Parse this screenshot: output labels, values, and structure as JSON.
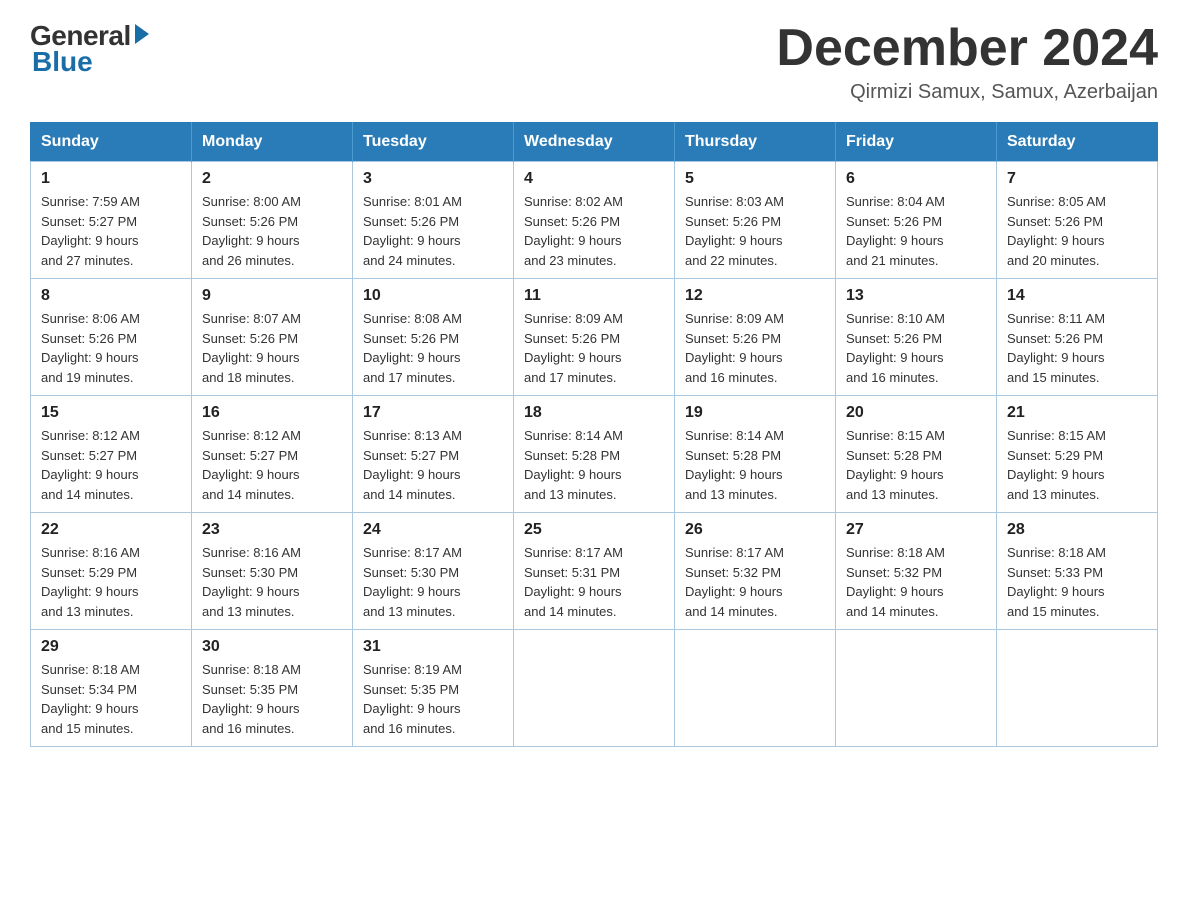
{
  "logo": {
    "general": "General",
    "blue": "Blue"
  },
  "header": {
    "title": "December 2024",
    "location": "Qirmizi Samux, Samux, Azerbaijan"
  },
  "weekdays": [
    "Sunday",
    "Monday",
    "Tuesday",
    "Wednesday",
    "Thursday",
    "Friday",
    "Saturday"
  ],
  "weeks": [
    [
      {
        "day": "1",
        "sunrise": "7:59 AM",
        "sunset": "5:27 PM",
        "daylight": "9 hours and 27 minutes."
      },
      {
        "day": "2",
        "sunrise": "8:00 AM",
        "sunset": "5:26 PM",
        "daylight": "9 hours and 26 minutes."
      },
      {
        "day": "3",
        "sunrise": "8:01 AM",
        "sunset": "5:26 PM",
        "daylight": "9 hours and 24 minutes."
      },
      {
        "day": "4",
        "sunrise": "8:02 AM",
        "sunset": "5:26 PM",
        "daylight": "9 hours and 23 minutes."
      },
      {
        "day": "5",
        "sunrise": "8:03 AM",
        "sunset": "5:26 PM",
        "daylight": "9 hours and 22 minutes."
      },
      {
        "day": "6",
        "sunrise": "8:04 AM",
        "sunset": "5:26 PM",
        "daylight": "9 hours and 21 minutes."
      },
      {
        "day": "7",
        "sunrise": "8:05 AM",
        "sunset": "5:26 PM",
        "daylight": "9 hours and 20 minutes."
      }
    ],
    [
      {
        "day": "8",
        "sunrise": "8:06 AM",
        "sunset": "5:26 PM",
        "daylight": "9 hours and 19 minutes."
      },
      {
        "day": "9",
        "sunrise": "8:07 AM",
        "sunset": "5:26 PM",
        "daylight": "9 hours and 18 minutes."
      },
      {
        "day": "10",
        "sunrise": "8:08 AM",
        "sunset": "5:26 PM",
        "daylight": "9 hours and 17 minutes."
      },
      {
        "day": "11",
        "sunrise": "8:09 AM",
        "sunset": "5:26 PM",
        "daylight": "9 hours and 17 minutes."
      },
      {
        "day": "12",
        "sunrise": "8:09 AM",
        "sunset": "5:26 PM",
        "daylight": "9 hours and 16 minutes."
      },
      {
        "day": "13",
        "sunrise": "8:10 AM",
        "sunset": "5:26 PM",
        "daylight": "9 hours and 16 minutes."
      },
      {
        "day": "14",
        "sunrise": "8:11 AM",
        "sunset": "5:26 PM",
        "daylight": "9 hours and 15 minutes."
      }
    ],
    [
      {
        "day": "15",
        "sunrise": "8:12 AM",
        "sunset": "5:27 PM",
        "daylight": "9 hours and 14 minutes."
      },
      {
        "day": "16",
        "sunrise": "8:12 AM",
        "sunset": "5:27 PM",
        "daylight": "9 hours and 14 minutes."
      },
      {
        "day": "17",
        "sunrise": "8:13 AM",
        "sunset": "5:27 PM",
        "daylight": "9 hours and 14 minutes."
      },
      {
        "day": "18",
        "sunrise": "8:14 AM",
        "sunset": "5:28 PM",
        "daylight": "9 hours and 13 minutes."
      },
      {
        "day": "19",
        "sunrise": "8:14 AM",
        "sunset": "5:28 PM",
        "daylight": "9 hours and 13 minutes."
      },
      {
        "day": "20",
        "sunrise": "8:15 AM",
        "sunset": "5:28 PM",
        "daylight": "9 hours and 13 minutes."
      },
      {
        "day": "21",
        "sunrise": "8:15 AM",
        "sunset": "5:29 PM",
        "daylight": "9 hours and 13 minutes."
      }
    ],
    [
      {
        "day": "22",
        "sunrise": "8:16 AM",
        "sunset": "5:29 PM",
        "daylight": "9 hours and 13 minutes."
      },
      {
        "day": "23",
        "sunrise": "8:16 AM",
        "sunset": "5:30 PM",
        "daylight": "9 hours and 13 minutes."
      },
      {
        "day": "24",
        "sunrise": "8:17 AM",
        "sunset": "5:30 PM",
        "daylight": "9 hours and 13 minutes."
      },
      {
        "day": "25",
        "sunrise": "8:17 AM",
        "sunset": "5:31 PM",
        "daylight": "9 hours and 14 minutes."
      },
      {
        "day": "26",
        "sunrise": "8:17 AM",
        "sunset": "5:32 PM",
        "daylight": "9 hours and 14 minutes."
      },
      {
        "day": "27",
        "sunrise": "8:18 AM",
        "sunset": "5:32 PM",
        "daylight": "9 hours and 14 minutes."
      },
      {
        "day": "28",
        "sunrise": "8:18 AM",
        "sunset": "5:33 PM",
        "daylight": "9 hours and 15 minutes."
      }
    ],
    [
      {
        "day": "29",
        "sunrise": "8:18 AM",
        "sunset": "5:34 PM",
        "daylight": "9 hours and 15 minutes."
      },
      {
        "day": "30",
        "sunrise": "8:18 AM",
        "sunset": "5:35 PM",
        "daylight": "9 hours and 16 minutes."
      },
      {
        "day": "31",
        "sunrise": "8:19 AM",
        "sunset": "5:35 PM",
        "daylight": "9 hours and 16 minutes."
      },
      null,
      null,
      null,
      null
    ]
  ],
  "labels": {
    "sunrise": "Sunrise: ",
    "sunset": "Sunset: ",
    "daylight": "Daylight: "
  }
}
